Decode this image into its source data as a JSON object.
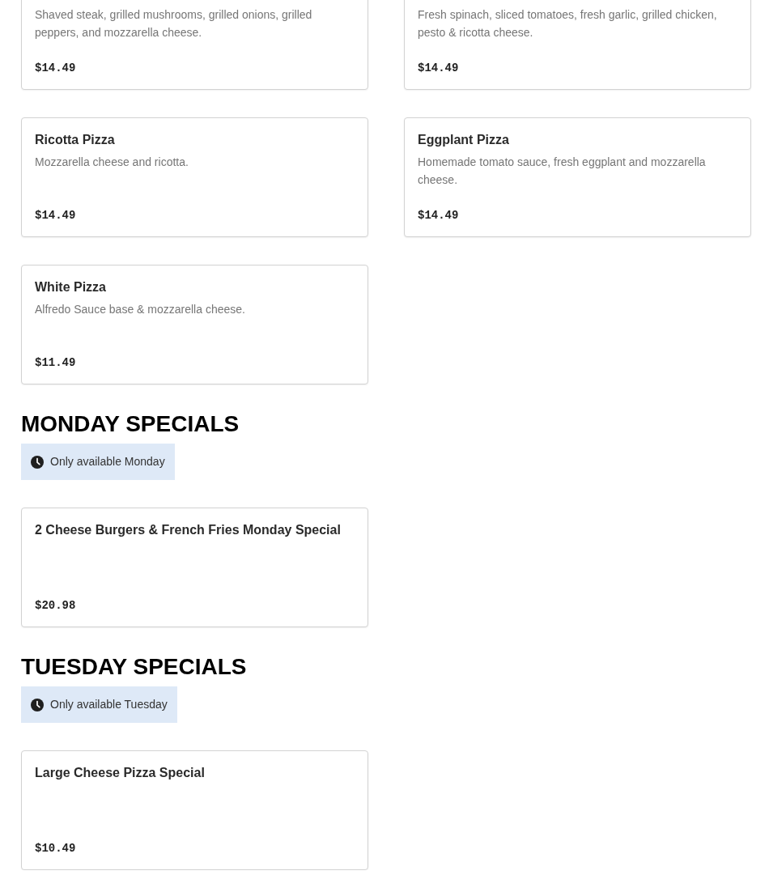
{
  "sections": [
    {
      "items": [
        {
          "description": "Shaved steak, grilled mushrooms, grilled onions, grilled peppers, and mozzarella cheese.",
          "price": "$14.49"
        },
        {
          "description": "Fresh spinach, sliced tomatoes, fresh garlic, grilled chicken, pesto & ricotta cheese.",
          "price": "$14.49"
        },
        {
          "title": "Ricotta Pizza",
          "description": "Mozzarella cheese and ricotta.",
          "price": "$14.49"
        },
        {
          "title": "Eggplant Pizza",
          "description": "Homemade tomato sauce, fresh eggplant and mozzarella cheese.",
          "price": "$14.49"
        },
        {
          "title": "White Pizza",
          "description": "Alfredo Sauce base & mozzarella cheese.",
          "price": "$11.49"
        }
      ]
    },
    {
      "heading": "MONDAY SPECIALS",
      "availability": "Only available Monday",
      "items": [
        {
          "title": "2 Cheese Burgers & French Fries Monday Special",
          "price": "$20.98"
        }
      ]
    },
    {
      "heading": "TUESDAY SPECIALS",
      "availability": "Only available Tuesday",
      "items": [
        {
          "title": "Large Cheese Pizza Special",
          "price": "$10.49"
        }
      ]
    }
  ]
}
